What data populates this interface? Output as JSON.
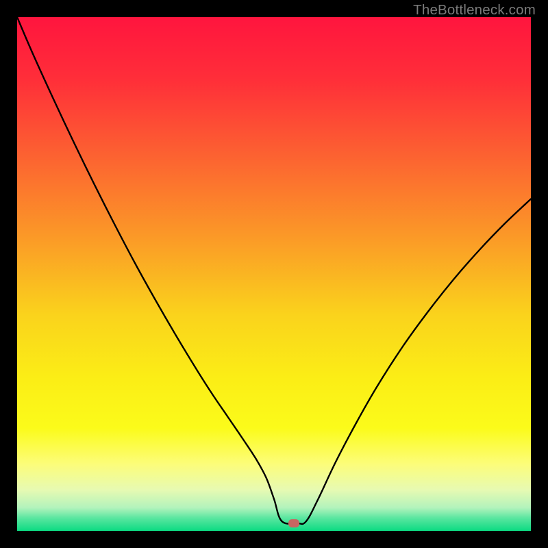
{
  "watermark": "TheBottleneck.com",
  "marker": {
    "color": "#c86662",
    "x_frac": 0.539,
    "y_frac": 0.985
  },
  "chart_data": {
    "type": "line",
    "title": "",
    "xlabel": "",
    "ylabel": "",
    "xlim": [
      0,
      100
    ],
    "ylim": [
      0,
      100
    ],
    "background_gradient_stops": [
      {
        "pos": 0.0,
        "color": "#ff153e"
      },
      {
        "pos": 0.12,
        "color": "#ff2e39"
      },
      {
        "pos": 0.27,
        "color": "#fc6231"
      },
      {
        "pos": 0.43,
        "color": "#fb9a27"
      },
      {
        "pos": 0.58,
        "color": "#fad31c"
      },
      {
        "pos": 0.7,
        "color": "#fbed16"
      },
      {
        "pos": 0.8,
        "color": "#fbfb1a"
      },
      {
        "pos": 0.87,
        "color": "#fcfd7a"
      },
      {
        "pos": 0.92,
        "color": "#e7fab2"
      },
      {
        "pos": 0.955,
        "color": "#b2f3bc"
      },
      {
        "pos": 0.975,
        "color": "#5ae6a0"
      },
      {
        "pos": 1.0,
        "color": "#0cdb82"
      }
    ],
    "series": [
      {
        "name": "bottleneck-curve",
        "x": [
          0.0,
          3.0,
          7.0,
          11.0,
          15.0,
          19.0,
          23.0,
          27.0,
          31.0,
          35.0,
          38.0,
          41.0,
          44.0,
          46.5,
          48.5,
          50.0,
          51.5,
          54.5,
          56.2,
          58.5,
          62.0,
          66.0,
          70.0,
          75.0,
          80.0,
          85.0,
          90.0,
          95.0,
          100.0
        ],
        "y": [
          100.0,
          93.0,
          84.2,
          75.7,
          67.5,
          59.6,
          52.0,
          44.8,
          37.9,
          31.3,
          26.6,
          22.2,
          17.8,
          14.0,
          10.3,
          6.2,
          1.9,
          1.5,
          1.8,
          6.0,
          13.4,
          21.0,
          28.0,
          35.8,
          42.7,
          49.0,
          54.7,
          59.9,
          64.6
        ]
      }
    ],
    "annotations": [
      {
        "name": "min-marker",
        "x": 53.9,
        "y": 1.5,
        "color": "#c86662"
      }
    ]
  }
}
